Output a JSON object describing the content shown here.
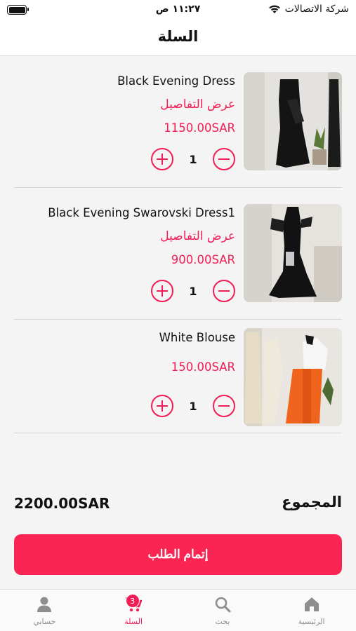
{
  "status_bar": {
    "carrier": "شركة الاتصالات",
    "time": "١١:٢٧ ص"
  },
  "header": {
    "title": "السلة"
  },
  "cart": {
    "items": [
      {
        "name": "Black Evening Dress",
        "details_label": "عرض التفاصيل",
        "price": "1150.00SAR",
        "quantity": "1"
      },
      {
        "name": "Black Evening Swarovski Dress1",
        "details_label": "عرض التفاصيل",
        "price": "900.00SAR",
        "quantity": "1"
      },
      {
        "name": "White Blouse",
        "price": "150.00SAR",
        "quantity": "1"
      }
    ],
    "total_label": "المجموع",
    "total_amount": "2200.00SAR",
    "checkout_label": "إتمام الطلب"
  },
  "tabbar": {
    "tabs": [
      {
        "label": "الرئيسية",
        "icon": "home-icon"
      },
      {
        "label": "بحث",
        "icon": "search-icon"
      },
      {
        "label": "السلة",
        "icon": "cart-icon",
        "badge": "3",
        "active": true
      },
      {
        "label": "حسابي",
        "icon": "user-icon"
      }
    ]
  },
  "colors": {
    "accent": "#f21d55",
    "button": "#fb2553"
  }
}
